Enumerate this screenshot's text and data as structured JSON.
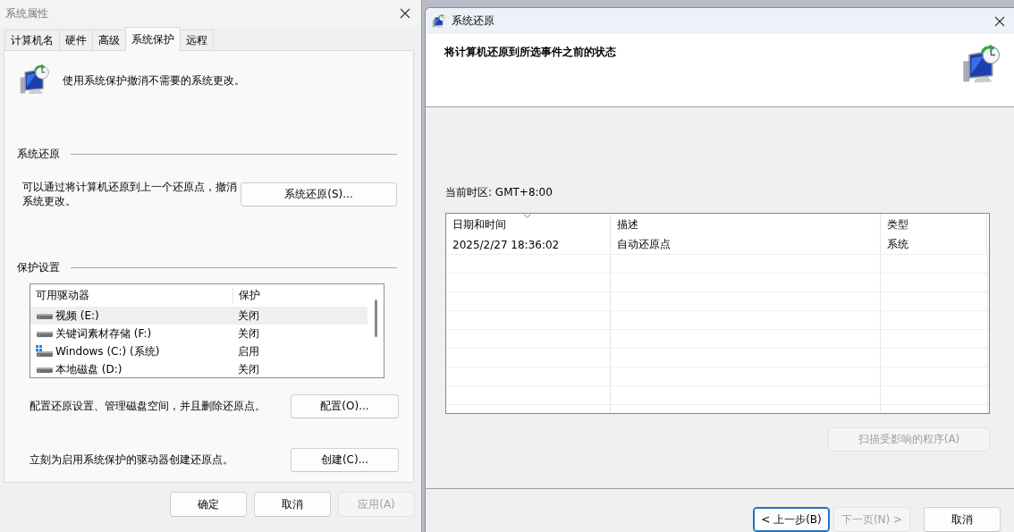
{
  "system_properties": {
    "title": "系统属性",
    "tabs": [
      {
        "label": "计算机名",
        "selected": false
      },
      {
        "label": "硬件",
        "selected": false
      },
      {
        "label": "高级",
        "selected": false
      },
      {
        "label": "系统保护",
        "selected": true
      },
      {
        "label": "远程",
        "selected": false
      }
    ],
    "intro": "使用系统保护撤消不需要的系统更改。",
    "restore_section": {
      "heading": "系统还原",
      "description": "可以通过将计算机还原到上一个还原点，撤消系统更改。",
      "button": "系统还原(S)..."
    },
    "protection_section": {
      "heading": "保护设置",
      "columns": [
        "可用驱动器",
        "保护"
      ],
      "drives": [
        {
          "name": "视频 (E:)",
          "protection": "关闭",
          "kind": "drive",
          "selected": true
        },
        {
          "name": "关键词素材存储 (F:)",
          "protection": "关闭",
          "kind": "drive",
          "selected": false
        },
        {
          "name": "Windows (C:) (系统)",
          "protection": "启用",
          "kind": "system",
          "selected": false
        },
        {
          "name": "本地磁盘 (D:)",
          "protection": "关闭",
          "kind": "drive",
          "selected": false
        }
      ],
      "configure": {
        "text": "配置还原设置、管理磁盘空间，并且删除还原点。",
        "button": "配置(O)..."
      },
      "create": {
        "text": "立刻为启用系统保护的驱动器创建还原点。",
        "button": "创建(C)..."
      }
    },
    "buttons": [
      {
        "label": "确定",
        "disabled": false
      },
      {
        "label": "取消",
        "disabled": false
      },
      {
        "label": "应用(A)",
        "disabled": true
      }
    ]
  },
  "system_restore": {
    "title": "系统还原",
    "heading": "将计算机还原到所选事件之前的状态",
    "timezone": "当前时区: GMT+8:00",
    "table": {
      "columns": [
        {
          "label": "日期和时间",
          "sorted": true
        },
        {
          "label": "描述",
          "sorted": false
        },
        {
          "label": "类型",
          "sorted": false
        }
      ],
      "rows": [
        [
          "2025/2/27 18:36:02",
          "自动还原点",
          "系统"
        ]
      ]
    },
    "scan_button": {
      "label": "扫描受影响的程序(A)",
      "disabled": true
    },
    "buttons": [
      {
        "label": "< 上一步(B)",
        "default": true,
        "disabled": false
      },
      {
        "label": "下一页(N) >",
        "default": false,
        "disabled": true
      },
      {
        "label": "取消",
        "default": false,
        "disabled": false
      }
    ]
  }
}
